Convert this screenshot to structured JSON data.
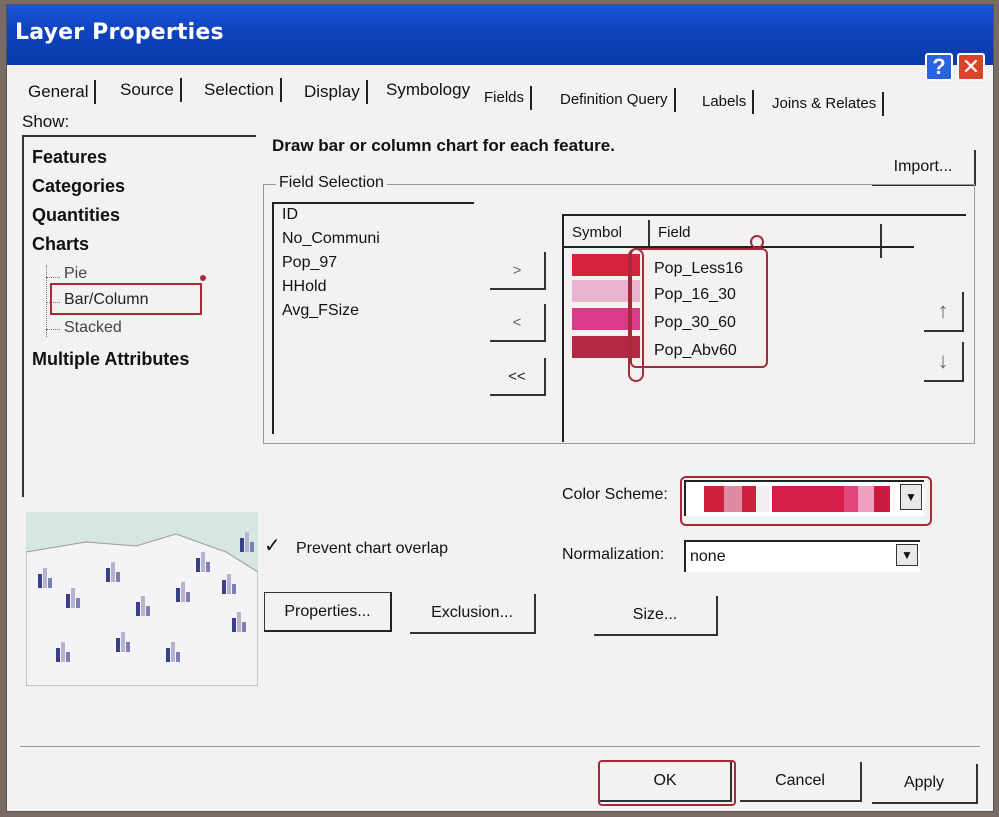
{
  "window": {
    "title": "Layer Properties"
  },
  "titlebar": {
    "help_label": "?",
    "close_label": "✕"
  },
  "tabs": [
    "General",
    "Source",
    "Selection",
    "Display",
    "Symbology",
    "Fields",
    "Definition Query",
    "Labels",
    "Joins & Relates"
  ],
  "show": {
    "label": "Show:",
    "categories": [
      "Features",
      "Categories",
      "Quantities",
      "Charts"
    ],
    "chart_types": [
      "Pie",
      "Bar/Column",
      "Stacked"
    ],
    "multiple": "Multiple Attributes",
    "selected": "Bar/Column"
  },
  "description": "Draw bar or column chart for each feature.",
  "import_label": "Import...",
  "field_selection": {
    "legend": "Field Selection",
    "available": [
      "ID",
      "No_Communi",
      "Pop_97",
      "HHold",
      "Avg_FSize"
    ],
    "move_buttons": [
      ">",
      "<",
      "<<"
    ],
    "headers": {
      "symbol": "Symbol",
      "field": "Field"
    },
    "selected_fields": [
      {
        "name": "Pop_Less16",
        "color": "#d8233c"
      },
      {
        "name": "Pop_16_30",
        "color": "#e7b3cf"
      },
      {
        "name": "Pop_30_60",
        "color": "#da3a8a"
      },
      {
        "name": "Pop_Abv60",
        "color": "#b42945"
      }
    ],
    "order_arrows": {
      "up": "↑",
      "down": "↓"
    }
  },
  "color_scheme": {
    "label": "Color Scheme:",
    "colors": [
      "#d01f3f",
      "#e08ba4",
      "#d01f3f",
      "#f4eef0",
      "#d41e4a",
      "#e0487a",
      "#f0a0c0",
      "#cc1a40"
    ]
  },
  "normalization": {
    "label": "Normalization:",
    "value": "none"
  },
  "prevent_overlap": {
    "label": "Prevent chart overlap",
    "check": "✓"
  },
  "buttons": {
    "properties": "Properties...",
    "exclusion": "Exclusion...",
    "size": "Size...",
    "ok": "OK",
    "cancel": "Cancel",
    "apply": "Apply"
  },
  "preview_colors": {
    "bars": [
      "#3a4088",
      "#b7b2d0",
      "#7a7fb6"
    ],
    "land": "#f4f3f6",
    "water": "#d6e6e2"
  }
}
